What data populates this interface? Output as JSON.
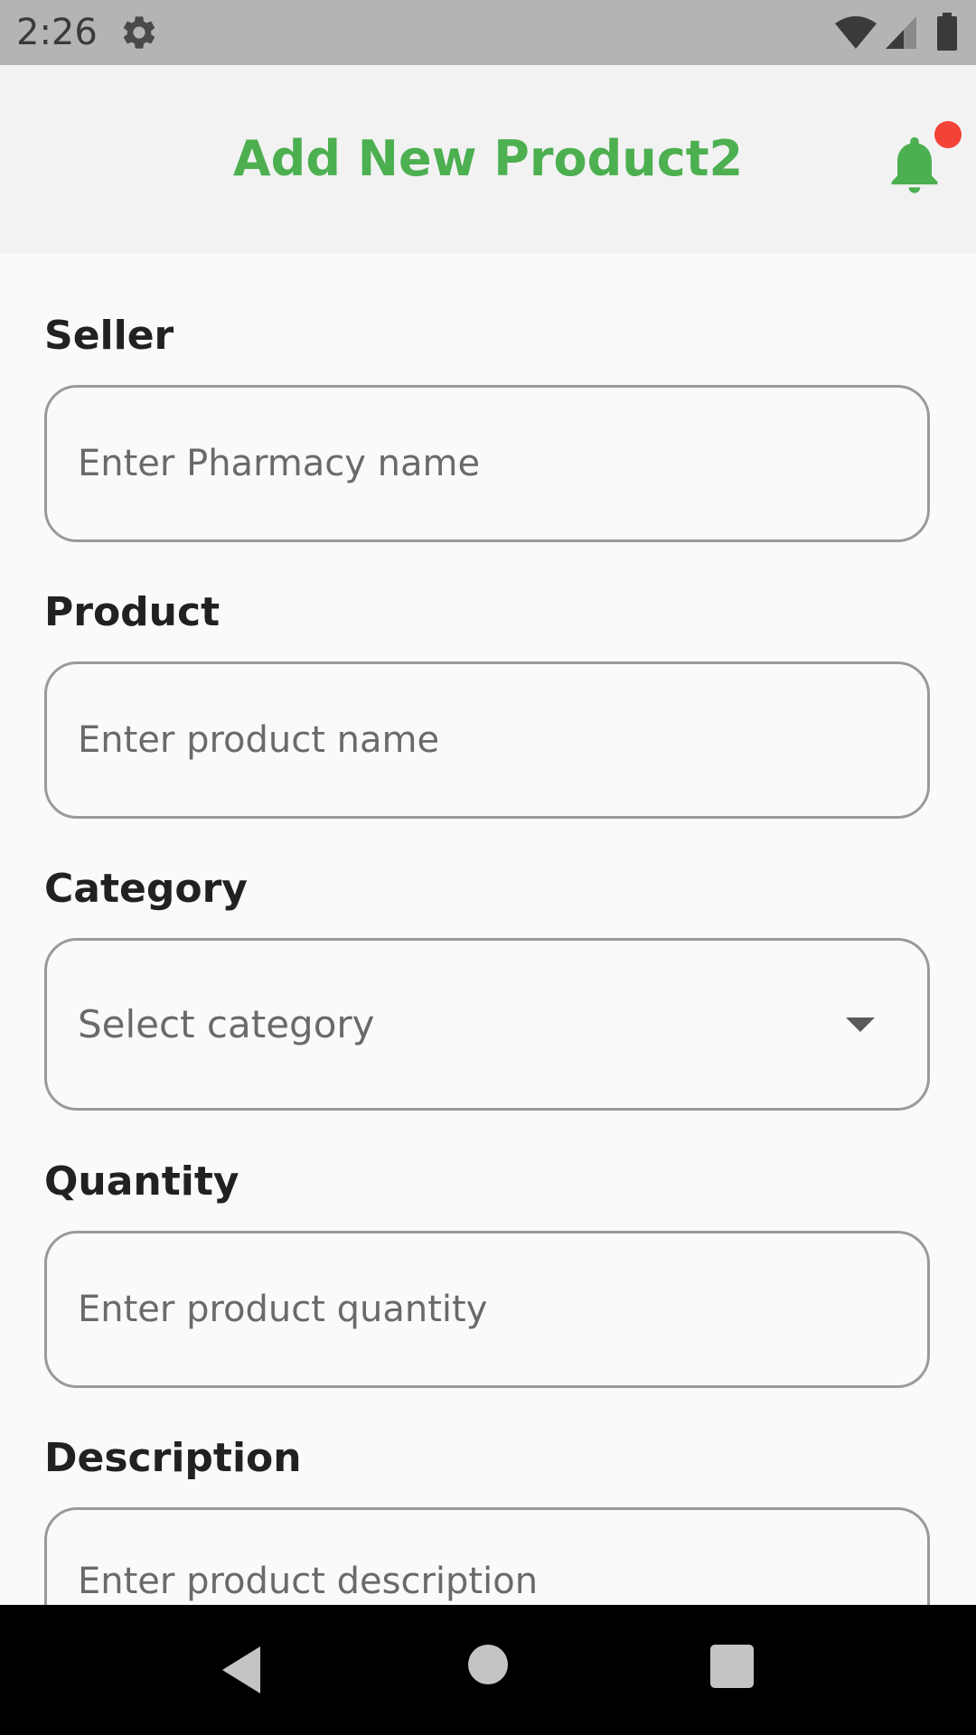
{
  "status_bar": {
    "time": "2:26",
    "icons": [
      "gear-icon",
      "wifi-icon",
      "signal-icon",
      "battery-icon"
    ],
    "background": "#b4b4b4"
  },
  "app_bar": {
    "title": "Add New Product2",
    "title_color": "#4caf50",
    "notification_icon": "bell-icon",
    "badge_color": "#f44336"
  },
  "form": {
    "seller": {
      "label": "Seller",
      "placeholder": "Enter Pharmacy name",
      "value": ""
    },
    "product": {
      "label": "Product",
      "placeholder": "Enter product name",
      "value": ""
    },
    "category": {
      "label": "Category",
      "selected_text": "Select category",
      "icon": "dropdown-arrow-icon"
    },
    "quantity": {
      "label": "Quantity",
      "placeholder": "Enter product quantity",
      "value": ""
    },
    "description": {
      "label": "Description",
      "placeholder": "Enter product description",
      "value": ""
    }
  },
  "nav_bar": {
    "icons": [
      "back-icon",
      "home-icon",
      "recents-icon"
    ]
  }
}
